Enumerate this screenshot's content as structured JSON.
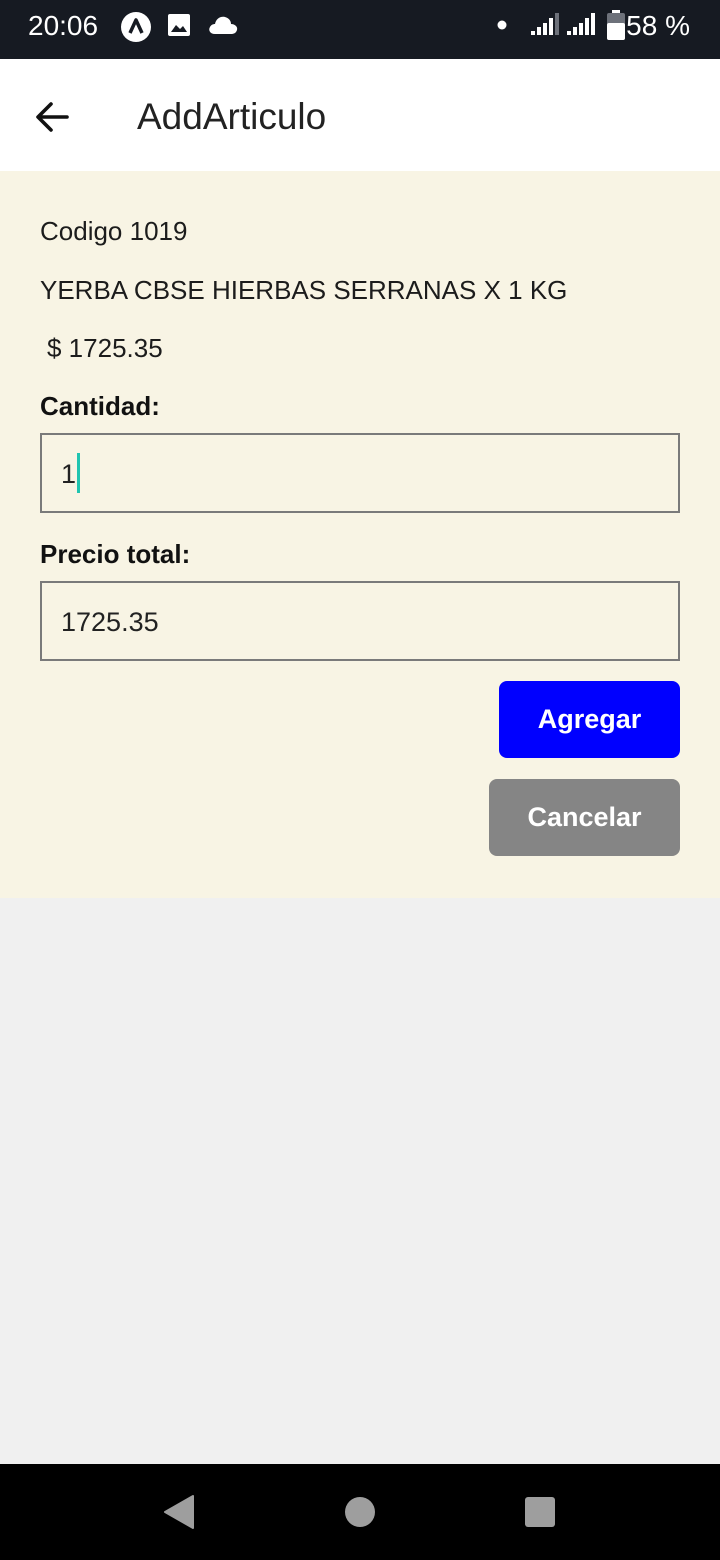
{
  "status_bar": {
    "time": "20:06",
    "battery": "58 %",
    "icons": [
      "app-a-icon",
      "image-icon",
      "cloud-icon",
      "dot-icon",
      "signal-icon",
      "signal-icon",
      "battery-icon"
    ]
  },
  "app_bar": {
    "title": "AddArticulo",
    "back_icon": "arrow-left-icon"
  },
  "article": {
    "code": "Codigo 1019",
    "description": "YERBA CBSE HIERBAS SERRANAS X 1 KG",
    "price": "$ 1725.35"
  },
  "form": {
    "quantity_label": "Cantidad:",
    "quantity_value": "1",
    "total_label": "Precio total:",
    "total_value": "1725.35"
  },
  "buttons": {
    "add_label": "Agregar",
    "cancel_label": "Cancelar",
    "add_color": "#0000ff",
    "cancel_color": "#858585"
  },
  "nav_bar": {
    "icons": [
      "back-triangle-icon",
      "home-circle-icon",
      "recents-square-icon"
    ]
  }
}
